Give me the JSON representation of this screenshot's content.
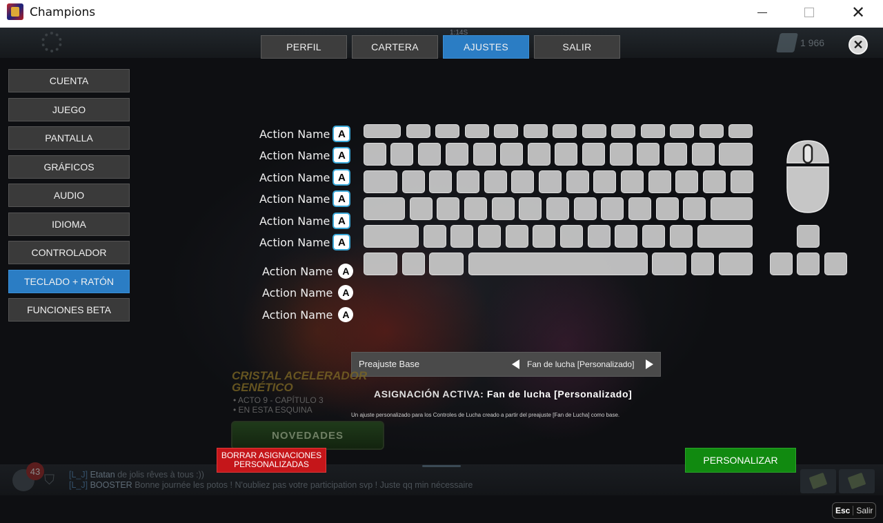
{
  "window": {
    "title": "Champions"
  },
  "top": {
    "timer": "1:14S",
    "currency": "1 966"
  },
  "tabs": [
    {
      "label": "PERFIL",
      "active": false
    },
    {
      "label": "CARTERA",
      "active": false
    },
    {
      "label": "AJUSTES",
      "active": true
    },
    {
      "label": "SALIR",
      "active": false
    }
  ],
  "sidebar": {
    "items": [
      {
        "label": "CUENTA"
      },
      {
        "label": "JUEGO"
      },
      {
        "label": "PANTALLA"
      },
      {
        "label": "GRÁFICOS"
      },
      {
        "label": "AUDIO"
      },
      {
        "label": "IDIOMA"
      },
      {
        "label": "CONTROLADOR"
      },
      {
        "label": "TECLADO + RATÓN",
        "active": true
      },
      {
        "label": "FUNCIONES BETA"
      }
    ]
  },
  "actions": {
    "keyboard": [
      {
        "label": "Action Name",
        "key": "A"
      },
      {
        "label": "Action Name",
        "key": "A"
      },
      {
        "label": "Action Name",
        "key": "A"
      },
      {
        "label": "Action Name",
        "key": "A"
      },
      {
        "label": "Action Name",
        "key": "A"
      },
      {
        "label": "Action Name",
        "key": "A"
      }
    ],
    "mouse": [
      {
        "label": "Action Name",
        "key": "A"
      },
      {
        "label": "Action Name",
        "key": "A"
      },
      {
        "label": "Action Name",
        "key": "A"
      }
    ]
  },
  "preset": {
    "label": "Preajuste Base",
    "value": "Fan de lucha [Personalizado]"
  },
  "active_assignment": {
    "label": "ASIGNACIÓN ACTIVA:",
    "value": "Fan de lucha [Personalizado]"
  },
  "description": "Un ajuste personalizado para los Controles de Lucha creado a partir del preajuste [Fan de Lucha] como base.",
  "promo": {
    "title_line1": "CRISTAL ACELERADOR",
    "title_line2": "GENÉTICO",
    "line1": "• ACTO 9 - CAPÍTULO 3",
    "line2": "• EN ESTA ESQUINA",
    "button": "NOVEDADES"
  },
  "buttons": {
    "reset": "BORRAR ASIGNACIONES PERSONALIZADAS",
    "customize": "PERSONALIZAR"
  },
  "chat": {
    "notification_count": "43",
    "messages": [
      {
        "tag": "[L_J]",
        "name": "Etatan",
        "text": "de jolis rêves à tous :))"
      },
      {
        "tag": "[L_J]",
        "name": "BOOSTER",
        "text": "Bonne journée les potos ! N'oubliez pas votre participation svp ! Juste qq min nécessaire"
      }
    ]
  },
  "esc_hint": {
    "key": "Esc",
    "label": "Salir"
  }
}
